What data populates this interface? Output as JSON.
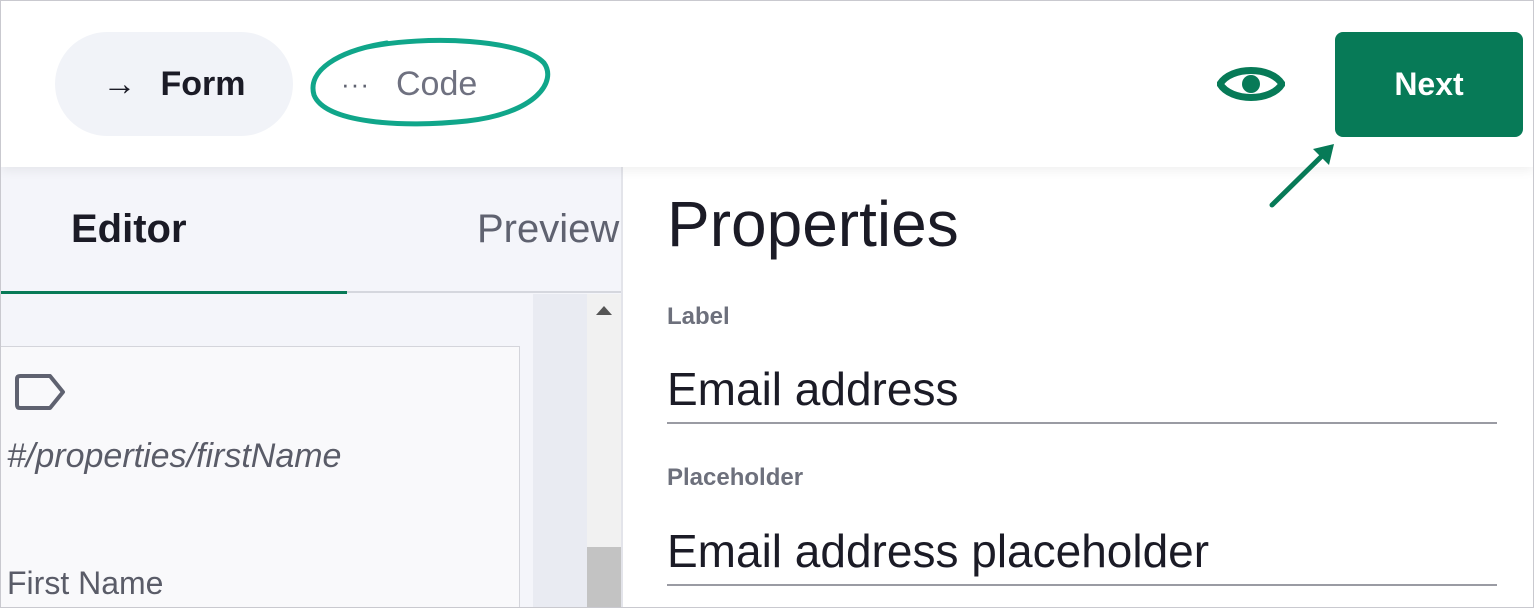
{
  "header": {
    "form_tab_arrow": "→",
    "form_tab_label": "Form",
    "code_tab_dots": "···",
    "code_tab_label": "Code",
    "next_label": "Next",
    "accent_color": "#077a57",
    "annotation_color": "#10a68a"
  },
  "editor": {
    "tabs": [
      {
        "label": "Editor",
        "active": true
      },
      {
        "label": "Preview",
        "active": false
      }
    ],
    "card": {
      "icon": "tag-icon",
      "scope": "#/properties/firstName",
      "field_label": "First Name"
    }
  },
  "properties": {
    "title": "Properties",
    "label_caption": "Label",
    "label_value": "Email address",
    "placeholder_caption": "Placeholder",
    "placeholder_value": "Email address placeholder"
  }
}
